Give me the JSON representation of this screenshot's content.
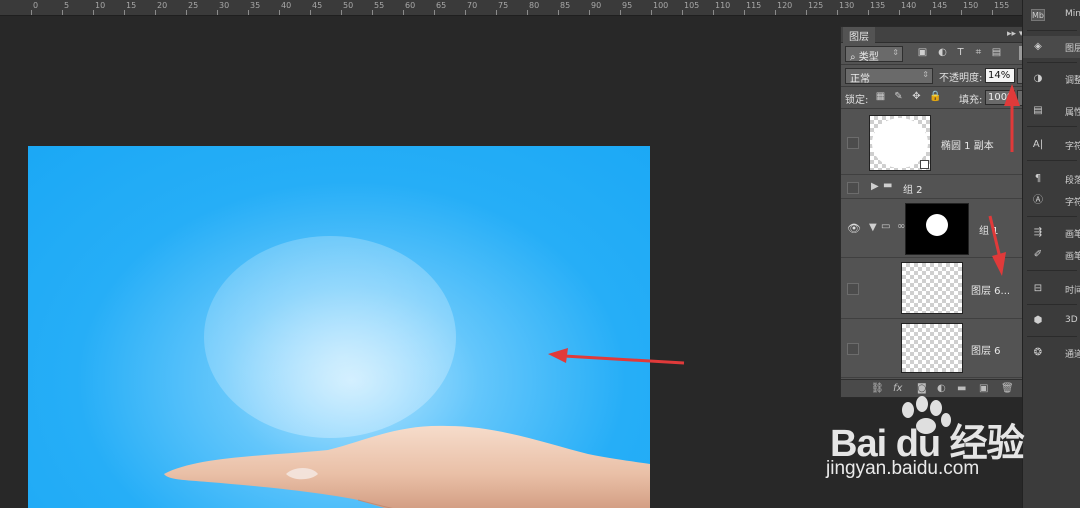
{
  "ruler": {
    "labels": [
      "0",
      "5",
      "10",
      "15",
      "20",
      "25",
      "30",
      "35",
      "40",
      "45",
      "50",
      "55",
      "60",
      "65",
      "70",
      "75",
      "80",
      "85",
      "90",
      "95",
      "100",
      "105",
      "110",
      "115",
      "120",
      "125",
      "130",
      "135",
      "140",
      "145",
      "150",
      "155",
      "160"
    ]
  },
  "layers_panel": {
    "tab_label": "图层",
    "filter_label": "类型",
    "blend_mode": "正常",
    "opacity_label": "不透明度:",
    "opacity_value": "14%",
    "lock_label": "锁定:",
    "fill_label": "填充:",
    "fill_value": "100%",
    "layers": [
      {
        "name": "椭圆 1 副本",
        "kind": "shape",
        "visible": false
      },
      {
        "name": "组 2",
        "kind": "group",
        "visible": false
      },
      {
        "name": "组 1",
        "kind": "group-mask",
        "visible": true
      },
      {
        "name": "图层 6...",
        "kind": "pixel",
        "visible": false
      },
      {
        "name": "图层 6",
        "kind": "pixel",
        "visible": false
      }
    ]
  },
  "right_strip": {
    "items": [
      {
        "label": "Min",
        "icon": "mini-bridge-icon"
      },
      {
        "label": "图层",
        "icon": "layers-icon"
      },
      {
        "label": "调整",
        "icon": "adjustments-icon"
      },
      {
        "label": "属性",
        "icon": "properties-icon"
      },
      {
        "label": "字符",
        "icon": "character-icon"
      },
      {
        "label": "段落",
        "icon": "paragraph-icon"
      },
      {
        "label": "字符",
        "icon": "character-style-icon"
      },
      {
        "label": "画笔",
        "icon": "brush-icon"
      },
      {
        "label": "画笔",
        "icon": "brush-presets-icon"
      },
      {
        "label": "时间",
        "icon": "timeline-icon"
      },
      {
        "label": "3D",
        "icon": "3d-icon"
      },
      {
        "label": "通道",
        "icon": "channels-icon"
      }
    ]
  },
  "watermark": {
    "brand": "Bai du 经验",
    "url": "jingyan.baidu.com"
  },
  "colors": {
    "arrow_red": "#e03a3a",
    "canvas_blue": "#1ba8f5"
  }
}
